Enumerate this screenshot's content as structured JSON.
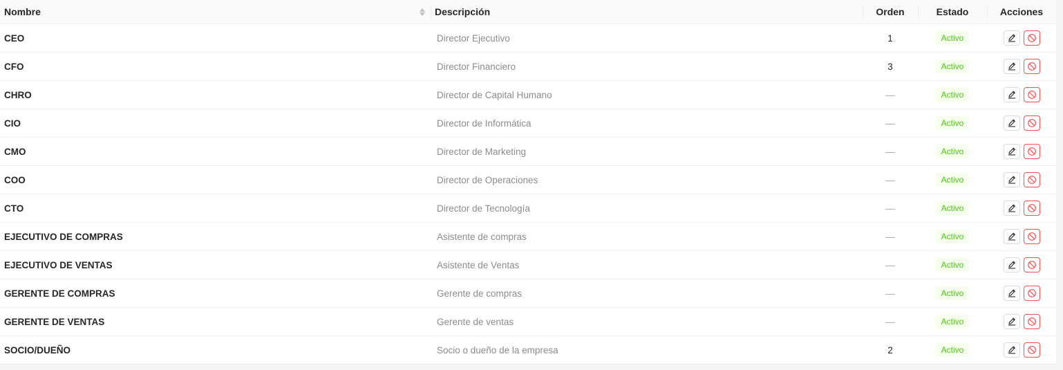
{
  "table": {
    "columns": {
      "nombre": "Nombre",
      "descripcion": "Descripción",
      "orden": "Orden",
      "estado": "Estado",
      "acciones": "Acciones"
    },
    "rows": [
      {
        "nombre": "CEO",
        "descripcion": "Director Ejecutivo",
        "orden": "1",
        "estado": "Activo"
      },
      {
        "nombre": "CFO",
        "descripcion": "Director Financiero",
        "orden": "3",
        "estado": "Activo"
      },
      {
        "nombre": "CHRO",
        "descripcion": "Director de Capital Humano",
        "orden": "—",
        "estado": "Activo"
      },
      {
        "nombre": "CIO",
        "descripcion": "Director de Informática",
        "orden": "—",
        "estado": "Activo"
      },
      {
        "nombre": "CMO",
        "descripcion": "Director de Marketing",
        "orden": "—",
        "estado": "Activo"
      },
      {
        "nombre": "COO",
        "descripcion": "Director de Operaciones",
        "orden": "—",
        "estado": "Activo"
      },
      {
        "nombre": "CTO",
        "descripcion": "Director de Tecnología",
        "orden": "—",
        "estado": "Activo"
      },
      {
        "nombre": "EJECUTIVO DE COMPRAS",
        "descripcion": "Asistente de compras",
        "orden": "—",
        "estado": "Activo"
      },
      {
        "nombre": "EJECUTIVO DE VENTAS",
        "descripcion": "Asistente de Ventas",
        "orden": "—",
        "estado": "Activo"
      },
      {
        "nombre": "GERENTE DE COMPRAS",
        "descripcion": "Gerente de compras",
        "orden": "—",
        "estado": "Activo"
      },
      {
        "nombre": "GERENTE DE VENTAS",
        "descripcion": "Gerente de ventas",
        "orden": "—",
        "estado": "Activo"
      },
      {
        "nombre": "SOCIO/DUEÑO",
        "descripcion": "Socio o dueño de la empresa",
        "orden": "2",
        "estado": "Activo"
      }
    ]
  },
  "icons": {
    "sort": "sort-icon",
    "edit": "edit-icon",
    "disable": "ban-icon"
  },
  "colors": {
    "active_text": "#52c41a",
    "active_bg": "#f6ffed",
    "danger": "#ff4d4f"
  }
}
